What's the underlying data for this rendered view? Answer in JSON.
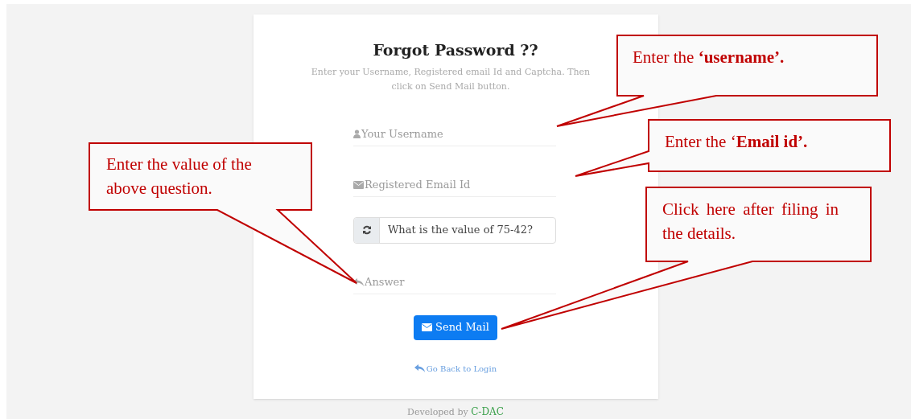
{
  "form": {
    "title": "Forgot Password ??",
    "description": "Enter your Username, Registered email Id and Captcha. Then click on Send Mail button.",
    "fields": [
      {
        "kind": "username",
        "placeholder": "Your Username"
      },
      {
        "kind": "email",
        "placeholder": "Registered Email Id"
      },
      {
        "kind": "captcha",
        "value": "What is the value of 75-42?"
      },
      {
        "kind": "answer",
        "placeholder": "Answer"
      }
    ],
    "button": "Send Mail",
    "link": "Go Back to Login"
  },
  "footer": {
    "prefix": "Developed by",
    "brand": "C-DAC"
  },
  "callouts": [
    {
      "text": "Enter the **‘username’.**"
    },
    {
      "text": "Enter the ‘**Email id’.**"
    },
    {
      "text": "Click here after filing in the details."
    },
    {
      "text": "Enter the value of the above question."
    }
  ]
}
